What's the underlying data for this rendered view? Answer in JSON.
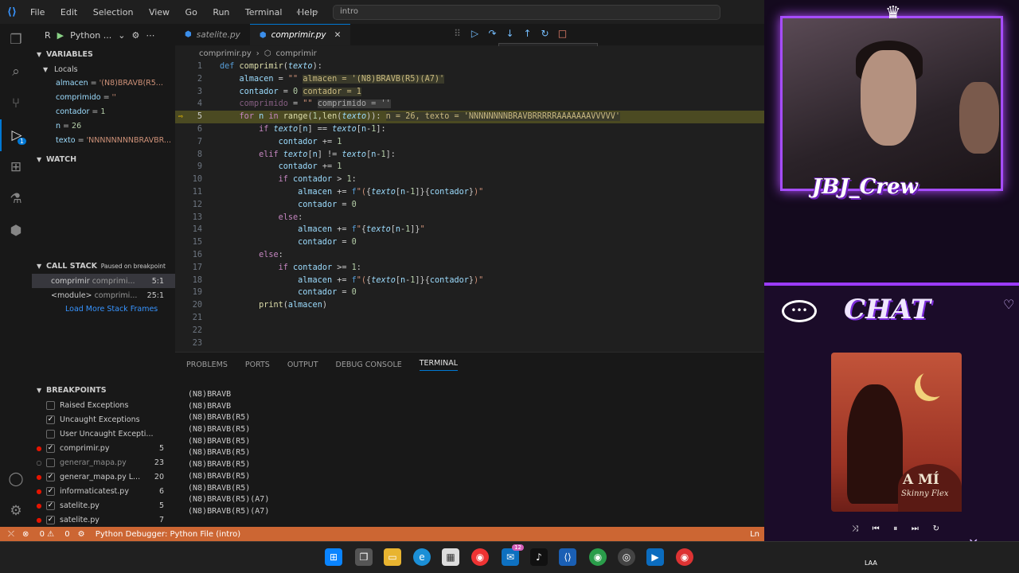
{
  "titlebar": {
    "menu": [
      "File",
      "Edit",
      "Selection",
      "View",
      "Go",
      "Run",
      "Terminal",
      "Help"
    ],
    "search": "intro"
  },
  "sidebar": {
    "run_config": "Python ...",
    "run_prefix": "R",
    "variables_header": "VARIABLES",
    "locals_header": "Locals",
    "locals": [
      {
        "name": "almacen",
        "value": "'(N8)BRAVB(R5..."
      },
      {
        "name": "comprimido",
        "value": "''"
      },
      {
        "name": "contador",
        "value": "1"
      },
      {
        "name": "n",
        "value": "26"
      },
      {
        "name": "texto",
        "value": "'NNNNNNNNBRAVBR..."
      }
    ],
    "watch_header": "WATCH",
    "callstack_header": "CALL STACK",
    "callstack_status": "Paused on breakpoint",
    "frames": [
      {
        "name": "comprimir",
        "file": "comprimi...",
        "pos": "5:1"
      },
      {
        "name": "<module>",
        "file": "comprimi...",
        "pos": "25:1"
      }
    ],
    "load_more": "Load More Stack Frames",
    "breakpoints_header": "BREAKPOINTS",
    "breakpoints": [
      {
        "label": "Raised Exceptions",
        "checked": false,
        "line": ""
      },
      {
        "label": "Uncaught Exceptions",
        "checked": true,
        "line": ""
      },
      {
        "label": "User Uncaught Excepti...",
        "checked": false,
        "line": ""
      },
      {
        "label": "comprimir.py",
        "checked": true,
        "line": "5"
      },
      {
        "label": "generar_mapa.py",
        "checked": false,
        "line": "23"
      },
      {
        "label": "generar_mapa.py   L...",
        "checked": true,
        "line": "20"
      },
      {
        "label": "informaticatest.py",
        "checked": true,
        "line": "6"
      },
      {
        "label": "satelite.py",
        "checked": true,
        "line": "5"
      },
      {
        "label": "satelite.py",
        "checked": true,
        "line": "7"
      }
    ]
  },
  "editor": {
    "tabs": [
      "satelite.py",
      "comprimir.py"
    ],
    "tooltip": "Restart (Ctrl+Shift+F5)",
    "breadcrumb_file": "comprimir.py",
    "breadcrumb_symbol": "comprimir",
    "line_numbers": [
      "1",
      "2",
      "3",
      "4",
      "5",
      "6",
      "7",
      "8",
      "9",
      "10",
      "11",
      "12",
      "13",
      "14",
      "15",
      "16",
      "17",
      "18",
      "19",
      "20",
      "21",
      "22",
      "23"
    ]
  },
  "panel": {
    "tabs": [
      "PROBLEMS",
      "PORTS",
      "OUTPUT",
      "DEBUG CONSOLE",
      "TERMINAL"
    ],
    "terminal_lines": [
      "(N8)BRAVB",
      "(N8)BRAVB",
      "(N8)BRAVB(R5)",
      "(N8)BRAVB(R5)",
      "(N8)BRAVB(R5)",
      "(N8)BRAVB(R5)",
      "(N8)BRAVB(R5)",
      "(N8)BRAVB(R5)",
      "(N8)BRAVB(R5)",
      "(N8)BRAVB(R5)(A7)",
      "(N8)BRAVB(R5)(A7)"
    ]
  },
  "statusbar": {
    "errors": "0",
    "warnings": "0",
    "debugger": "Python Debugger: Python File (intro)",
    "right": "Ln"
  },
  "overlay": {
    "crew": "JBJ_Crew",
    "chat": "CHAT",
    "album_title": "A MÍ",
    "album_artist": "Skinny Flex",
    "tray": "LAA"
  },
  "colors": {
    "accent": "#0078d4",
    "statusbar": "#cc6633",
    "purple": "#a64dff"
  }
}
